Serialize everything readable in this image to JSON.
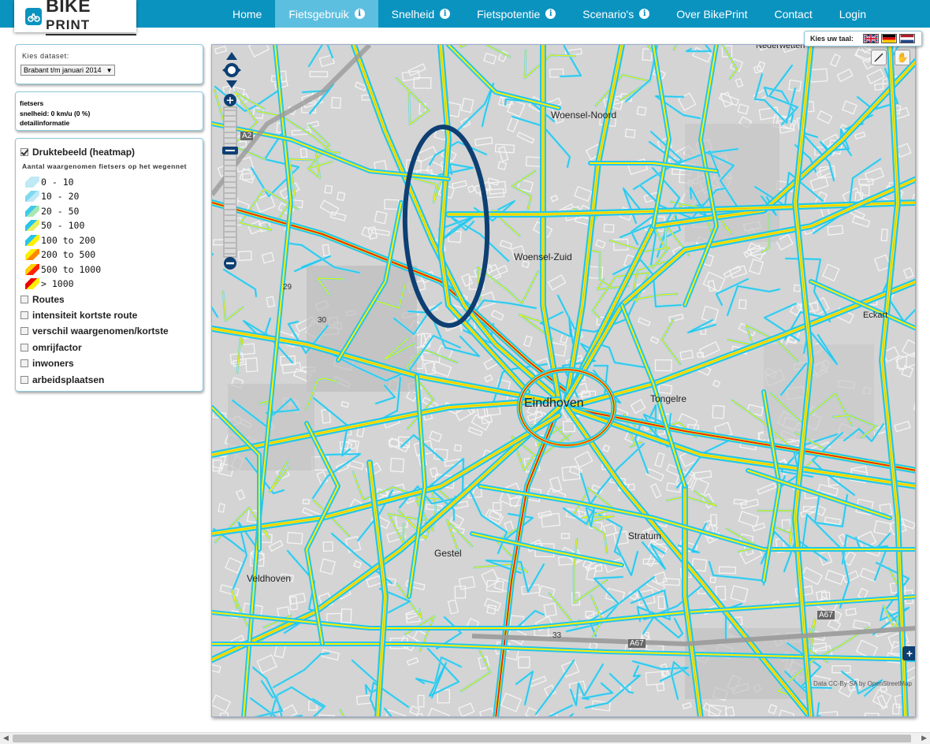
{
  "brand": {
    "logo_bike": "BIKE",
    "logo_print": "PRINT"
  },
  "nav": {
    "items": [
      {
        "label": "Home",
        "info": false,
        "active": false
      },
      {
        "label": "Fietsgebruik",
        "info": true,
        "active": true
      },
      {
        "label": "Snelheid",
        "info": true,
        "active": false
      },
      {
        "label": "Fietspotentie",
        "info": true,
        "active": false
      },
      {
        "label": "Scenario's",
        "info": true,
        "active": false
      },
      {
        "label": "Over BikePrint",
        "info": false,
        "active": false
      },
      {
        "label": "Contact",
        "info": false,
        "active": false
      },
      {
        "label": "Login",
        "info": false,
        "active": false
      }
    ]
  },
  "dataset": {
    "label": "Kies dataset:",
    "selected": "Brabant t/m januari 2014"
  },
  "info_panel": {
    "line1": "fietsers",
    "line2": "snelheid: 0 km/u (0 %)",
    "line3": "detailinformatie"
  },
  "layers": {
    "heatmap": {
      "label": "Druktebeeld (heatmap)",
      "checked": true
    },
    "legend_caption": "Aantal waargenomen fietsers op het wegennet",
    "legend": [
      {
        "label": "0 - 10",
        "colors": [
          "#bfe9f5",
          "#bfe9f5"
        ]
      },
      {
        "label": "10 - 20",
        "colors": [
          "#7fd9f0",
          "#bfe9f5"
        ]
      },
      {
        "label": "20 - 50",
        "colors": [
          "#3fc9ea",
          "#a8e8b0"
        ]
      },
      {
        "label": "50 - 100",
        "colors": [
          "#26c5ec",
          "#e8f060"
        ]
      },
      {
        "label": "100 to 200",
        "colors": [
          "#26c5ec",
          "#ffee00"
        ]
      },
      {
        "label": "200 to 500",
        "colors": [
          "#ffee00",
          "#ff8800"
        ]
      },
      {
        "label": "500 to 1000",
        "colors": [
          "#ffd000",
          "#ff2200"
        ]
      },
      {
        "label": "> 1000",
        "colors": [
          "#ee0000",
          "#ffee00"
        ]
      }
    ],
    "others": [
      {
        "label": "Routes",
        "checked": false
      },
      {
        "label": "intensiteit kortste route",
        "checked": false
      },
      {
        "label": "verschil waargenomen/kortste",
        "checked": false
      },
      {
        "label": "omrijfactor",
        "checked": false
      },
      {
        "label": "inwoners",
        "checked": false
      },
      {
        "label": "arbeidsplaatsen",
        "checked": false
      }
    ]
  },
  "language": {
    "label": "Kies uw taal:"
  },
  "map": {
    "places": [
      {
        "name": "Eindhoven",
        "key": "eindhoven"
      },
      {
        "name": "Woensel-Zuid",
        "key": "wzuid"
      },
      {
        "name": "Woensel-Noord",
        "key": "wnoord"
      },
      {
        "name": "Gestel",
        "key": "gestel"
      },
      {
        "name": "Stratum",
        "key": "stratum"
      },
      {
        "name": "Veldhoven",
        "key": "veldhoven"
      },
      {
        "name": "Tongelre",
        "key": "tongelre"
      },
      {
        "name": "Eckart",
        "key": "eckart"
      },
      {
        "name": "Nederwetten",
        "key": "nederwetten"
      }
    ],
    "road_labels": [
      "A2",
      "A67",
      "A67",
      "29",
      "30",
      "33"
    ],
    "attribution": "Data CC-By-SA by OpenStreetMap"
  },
  "colors": {
    "nav_bg": "#0b93c0",
    "nav_active": "#5cbfe0",
    "road_cyan": "#23c7ec",
    "road_yellow": "#ffee00",
    "road_red": "#e81e00",
    "highlight": "#0d3f73"
  }
}
